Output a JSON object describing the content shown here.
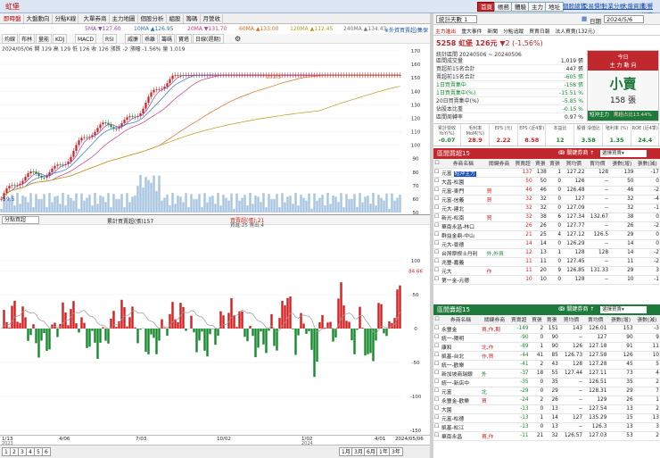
{
  "app": {
    "title": "虹堡"
  },
  "top_menu": [
    "即時盤",
    "大盤動向",
    "分點K線",
    "大單券商",
    "主力地圖",
    "個股分析",
    "組股",
    "籌碼",
    "月營收"
  ],
  "top_right_buttons": [
    "首頁",
    "帳務",
    "體驗",
    "主力",
    "地址"
  ],
  "top_right_links": [
    "個股總覽",
    "交易慣性",
    "行業分析",
    "大盤資訊",
    "影響幅度"
  ],
  "ma_legend": {
    "ma5": "5MA ▼127.60",
    "ma10": "10MA ▲126.95",
    "ma20": "20MA ▼131.70",
    "ma60": "60MA ▲133.00",
    "ma120": "120MA ▲112.45",
    "ma240": "240MA ▲134.43",
    "hint": "※外資買賣超/集保"
  },
  "toolbar": [
    "均線",
    "布林",
    "量能",
    "KDJ",
    "MACD",
    "RSI",
    "威廉",
    "乖離",
    "籌碼",
    "寶塔",
    "日線(週期)"
  ],
  "ohlc": "2024/05/06 開 129 高 129 低 126 收 126 漲跌 -2 漲幅 -1.56% 量 1,019",
  "price_axis": [
    "170",
    "160",
    "150",
    "140",
    "130",
    "120",
    "110",
    "100",
    "90",
    "80",
    "70",
    "60",
    "50"
  ],
  "price_annotations": {
    "high": "153.5",
    "low": "59.5"
  },
  "sub_header": {
    "select": "分點買超",
    "series1": "累計買賣超(張)157",
    "series2": "買賣超(張):21",
    "series3": "買進:25 賣出:4"
  },
  "sub_axis": [
    "100",
    "84.66",
    "50",
    "0",
    "-50",
    "-100",
    "-150"
  ],
  "date_axis": [
    "1/13",
    "4/06",
    "7/03",
    "10/02",
    "1/02",
    "4/01",
    "2024/05/06"
  ],
  "date_axis_sub": [
    "2023",
    "",
    "",
    "",
    "2024",
    "",
    ""
  ],
  "bottom": {
    "pages": [
      "1",
      "2",
      "3",
      "4",
      "5",
      "6"
    ],
    "periods": [
      "1月",
      "3月",
      "6月",
      "1年",
      "3年"
    ],
    "range": "2024/05/06"
  },
  "right": {
    "stats_select": "統計天數 1",
    "date_label": "日期",
    "date_value": "2024/5/6",
    "tabs": [
      "主力進出",
      "重大事件",
      "新聞",
      "分點追蹤",
      "買賣日報",
      "法人買賣(132元)"
    ],
    "stock": {
      "code": "5258",
      "name": "虹堡",
      "price": "126元",
      "change": "▼2 (-1.56%)"
    },
    "period_label": "統計區間 20240506 ~ 20240506",
    "stats": [
      {
        "label": "區間成交量",
        "value": "1,019 張"
      },
      {
        "label": "買超前15名合計",
        "value": "447 張"
      },
      {
        "label": "賣超前15名合計",
        "value": "-605 張"
      },
      {
        "label": "1日買賣集中",
        "value": "-158 張"
      },
      {
        "label": "1日買賣集中(%)",
        "value": "-15.51 %"
      },
      {
        "label": "20日買賣集中(%)",
        "value": "-5.85 %"
      },
      {
        "label": "佔股本比重",
        "value": "-0.15 %"
      },
      {
        "label": "區間周轉率",
        "value": "0.97 %"
      }
    ],
    "verdict": {
      "title": "今日",
      "subtitle": "主 力 動 向",
      "main": "小賣",
      "amount": "158 張",
      "footer1": "短沖主力",
      "footer2": "賣超占比13.44%"
    },
    "metrics": [
      {
        "label": "累計營收 YoY(%)",
        "value": "-0.07"
      },
      {
        "label": "毛利率 MoM(%)",
        "value": "28.9"
      },
      {
        "label": "EPS (元)",
        "value": "2.22"
      },
      {
        "label": "EPS (近4季)",
        "value": "8.58"
      },
      {
        "label": "本益比",
        "value": "12"
      },
      {
        "label": "股價 淨值比",
        "value": "3.58"
      },
      {
        "label": "殖利率 (%)",
        "value": "1.35"
      },
      {
        "label": "ROE (近4季)",
        "value": "24.4"
      }
    ],
    "buy_header": "區間買超15",
    "sell_header": "區間賣超15",
    "sort_label": "ↂ 關鍵券商 ↑",
    "columns": [
      "券商名稱",
      "關鍵券商",
      "買賣超",
      "買張",
      "賣張",
      "買均價",
      "賣均價",
      "張數(增)",
      "張數(減)"
    ],
    "buy_rows": [
      [
        "元富",
        "短沖主力",
        "",
        "137",
        "138",
        "1",
        "127.22",
        "128",
        "139",
        "-17"
      ],
      [
        "大昌-松園",
        "",
        "",
        "50",
        "50",
        "0",
        "126",
        "--",
        "50",
        "0"
      ],
      [
        "元富-東門",
        "",
        "買",
        "46",
        "46",
        "0",
        "126.48",
        "--",
        "46",
        "-2"
      ],
      [
        "元富-信義",
        "",
        "買",
        "32",
        "32",
        "0",
        "127",
        "--",
        "32",
        "-4"
      ],
      [
        "元大-建北",
        "",
        "",
        "32",
        "32",
        "0",
        "127.09",
        "--",
        "32",
        "-1"
      ],
      [
        "新光-松南",
        "",
        "買",
        "32",
        "38",
        "6",
        "127.34",
        "132.67",
        "38",
        "0"
      ],
      [
        "華南永昌-林口",
        "",
        "",
        "26",
        "26",
        "0",
        "127.77",
        "--",
        "26",
        "-2"
      ],
      [
        "群益金鼎-中山",
        "",
        "",
        "21",
        "25",
        "4",
        "127.12",
        "126.5",
        "29",
        "0"
      ],
      [
        "元大-景德",
        "",
        "",
        "14",
        "14",
        "0",
        "126.29",
        "--",
        "14",
        "0"
      ],
      [
        "台灣摩根士丹利",
        "",
        "外,外資",
        "12",
        "13",
        "1",
        "128",
        "128",
        "14",
        "-2"
      ],
      [
        "兆豐-嘉義",
        "",
        "",
        "11",
        "11",
        "0",
        "127.45",
        "--",
        "11",
        "-2"
      ],
      [
        "元大",
        "",
        "作",
        "11",
        "20",
        "9",
        "126.85",
        "131.33",
        "29",
        "3"
      ],
      [
        "第一金-元德",
        "",
        "",
        "10",
        "10",
        "0",
        "128",
        "--",
        "10",
        "-1"
      ]
    ],
    "sell_rows": [
      [
        "永豐金",
        "",
        "買,作,期",
        "-149",
        "2",
        "151",
        "143",
        "126.01",
        "153",
        "-3"
      ],
      [
        "統一-陽明",
        "",
        "",
        "-90",
        "0",
        "90",
        "--",
        "127",
        "90",
        "9"
      ],
      [
        "康和",
        "",
        "北,作",
        "-89",
        "1",
        "90",
        "126",
        "127.18",
        "91",
        "11"
      ],
      [
        "凱基-台北",
        "",
        "作,買",
        "-44",
        "41",
        "85",
        "126.73",
        "127.58",
        "126",
        "10"
      ],
      [
        "統一-歡樂",
        "",
        "",
        "-41",
        "2",
        "43",
        "128",
        "127.28",
        "45",
        "5"
      ],
      [
        "新加坡商瑞銀",
        "",
        "外",
        "-37",
        "18",
        "55",
        "127.44",
        "127.11",
        "73",
        "4"
      ],
      [
        "統一-新店中",
        "",
        "",
        "-35",
        "0",
        "35",
        "--",
        "126.51",
        "35",
        "2"
      ],
      [
        "元富",
        "",
        "北",
        "-29",
        "0",
        "29",
        "--",
        "128.31",
        "29",
        "7"
      ],
      [
        "永豐金-歡樂",
        "",
        "買",
        "-24",
        "2",
        "26",
        "--",
        "129",
        "26",
        "1"
      ],
      [
        "大園",
        "",
        "",
        "-13",
        "0",
        "13",
        "--",
        "127.54",
        "13",
        "2"
      ],
      [
        "元富-松德",
        "",
        "",
        "-13",
        "1",
        "14",
        "127",
        "135.29",
        "15",
        "13"
      ],
      [
        "凱基-松江",
        "",
        "",
        "-13",
        "0",
        "13",
        "--",
        "126.3",
        "13",
        "3"
      ],
      [
        "華南永昌",
        "",
        "買,作",
        "-11",
        "21",
        "32",
        "126.57",
        "127.03",
        "53",
        "2"
      ]
    ]
  },
  "colors": {
    "red": "#c0282d",
    "green": "#1d7a3a",
    "up": "#d41f1f",
    "down": "#168a2e"
  }
}
